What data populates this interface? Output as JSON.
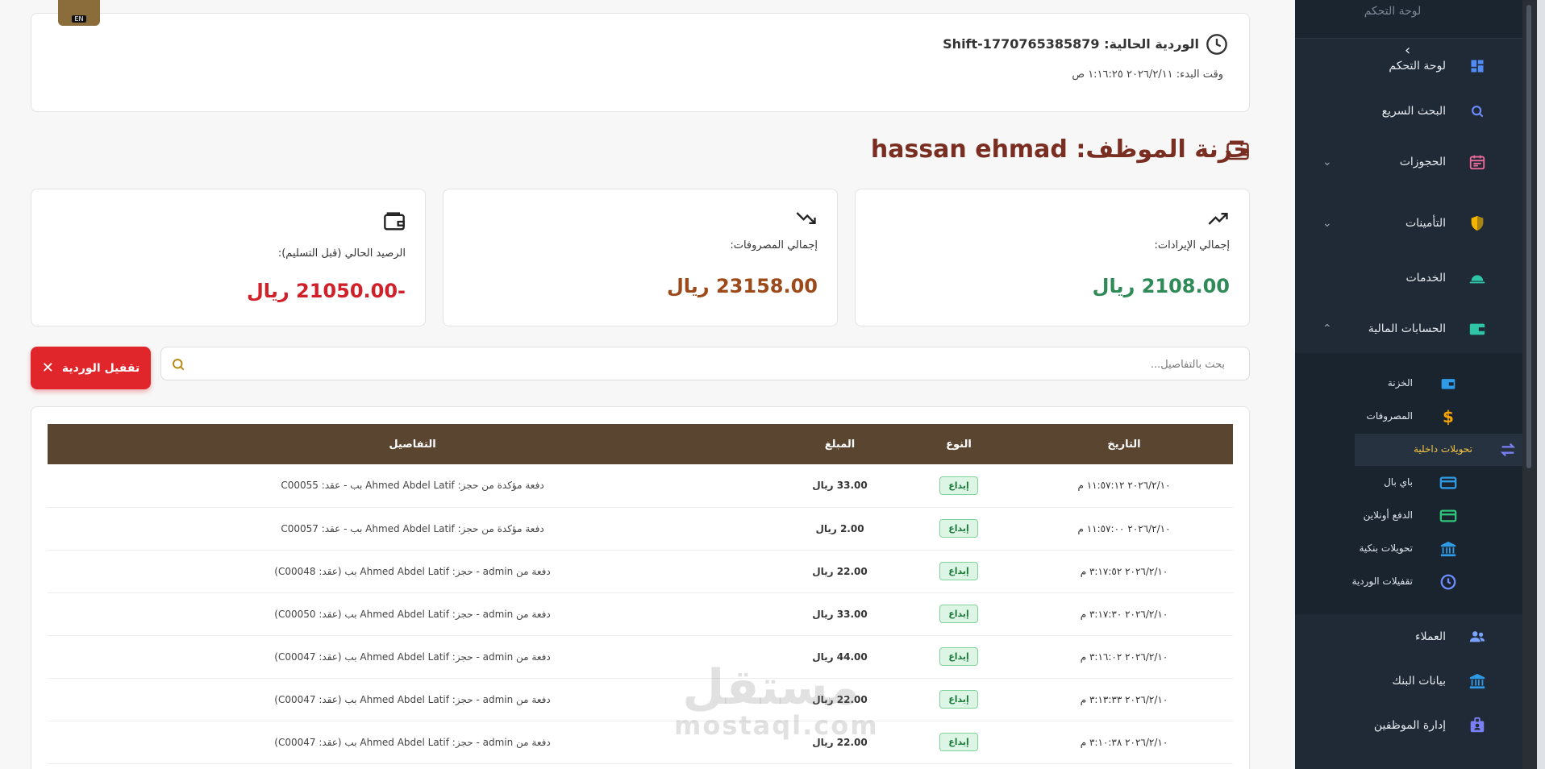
{
  "lang_badge": "EN",
  "shift": {
    "title": "الوردية الحالية: Shift-1770765385879",
    "start_time": "وقت البدء: ٢٠٢٦/٢/١١ ١:١٦:٢٥ ص"
  },
  "page_title": "خزنة الموظف: hassan ehmad",
  "stats": {
    "revenue": {
      "label": "إجمالي الإيرادات:",
      "value": "2108.00 ريال",
      "color": "#2e8b57"
    },
    "expenses": {
      "label": "إجمالي المصروفات:",
      "value": "23158.00 ريال",
      "color": "#9c4a1a"
    },
    "balance": {
      "label": "الرصيد الحالي (قبل التسليم):",
      "value": "-21050.00 ريال",
      "color": "#d0202a"
    }
  },
  "search": {
    "placeholder": "بحث بالتفاصيل..."
  },
  "close_shift_button": "تقفيل الوردية",
  "table": {
    "headers": {
      "date": "التاريخ",
      "type": "النوع",
      "amount": "المبلغ",
      "details": "التفاصيل"
    },
    "rows": [
      {
        "date": "٢٠٢٦/٢/١٠ ١١:٥٧:١٢ م",
        "type": "إيداع",
        "amount": "33.00 ريال",
        "details": "دفعة مؤكدة من حجز: Ahmed Abdel Latif بب - عقد: C00055"
      },
      {
        "date": "٢٠٢٦/٢/١٠ ١١:٥٧:٠٠ م",
        "type": "إيداع",
        "amount": "2.00 ريال",
        "details": "دفعة مؤكدة من حجز: Ahmed Abdel Latif بب - عقد: C00057"
      },
      {
        "date": "٢٠٢٦/٢/١٠ ٣:١٧:٥٢ م",
        "type": "إيداع",
        "amount": "22.00 ريال",
        "details": "دفعة من admin - حجز: Ahmed Abdel Latif بب (عقد: C00048)"
      },
      {
        "date": "٢٠٢٦/٢/١٠ ٣:١٧:٣٠ م",
        "type": "إيداع",
        "amount": "33.00 ريال",
        "details": "دفعة من admin - حجز: Ahmed Abdel Latif بب (عقد: C00050)"
      },
      {
        "date": "٢٠٢٦/٢/١٠ ٣:١٦:٠٢ م",
        "type": "إيداع",
        "amount": "44.00 ريال",
        "details": "دفعة من admin - حجز: Ahmed Abdel Latif بب (عقد: C00047)"
      },
      {
        "date": "٢٠٢٦/٢/١٠ ٣:١٣:٣٣ م",
        "type": "إيداع",
        "amount": "22.00 ريال",
        "details": "دفعة من admin - حجز: Ahmed Abdel Latif بب (عقد: C00047)"
      },
      {
        "date": "٢٠٢٦/٢/١٠ ٣:١٠:٣٨ م",
        "type": "إيداع",
        "amount": "22.00 ريال",
        "details": "دفعة من admin - حجز: Ahmed Abdel Latif بب (عقد: C00047)"
      }
    ]
  },
  "sidebar": {
    "header_label": "لوحة التحكم",
    "items": [
      {
        "label": "لوحة التحكم",
        "icon": "dashboard-icon"
      },
      {
        "label": "البحث السريع",
        "icon": "search-icon"
      },
      {
        "label": "الحجوزات",
        "icon": "calendar-icon"
      },
      {
        "label": "التأمينات",
        "icon": "shield-icon"
      },
      {
        "label": "الخدمات",
        "icon": "service-bell-icon"
      },
      {
        "label": "الحسابات المالية",
        "icon": "wallet-icon"
      }
    ],
    "sub_items": [
      {
        "label": "الخزنة",
        "icon": "wallet-icon"
      },
      {
        "label": "المصروفات",
        "icon": "dollar-icon"
      },
      {
        "label": "تحويلات داخلية",
        "icon": "transfer-arrows-icon"
      },
      {
        "label": "باي بال",
        "icon": "card-icon"
      },
      {
        "label": "الدفع أونلاين",
        "icon": "credit-card-icon"
      },
      {
        "label": "تحويلات بنكية",
        "icon": "bank-icon"
      },
      {
        "label": "تقفيلات الوردية",
        "icon": "clock-icon"
      }
    ],
    "bottom_items": [
      {
        "label": "العملاء",
        "icon": "users-icon"
      },
      {
        "label": "بيانات البنك",
        "icon": "bank-icon"
      },
      {
        "label": "إدارة الموظفين",
        "icon": "id-badge-icon"
      }
    ]
  },
  "watermark": {
    "arabic": "مستقل",
    "latin": "mostaql.com"
  }
}
